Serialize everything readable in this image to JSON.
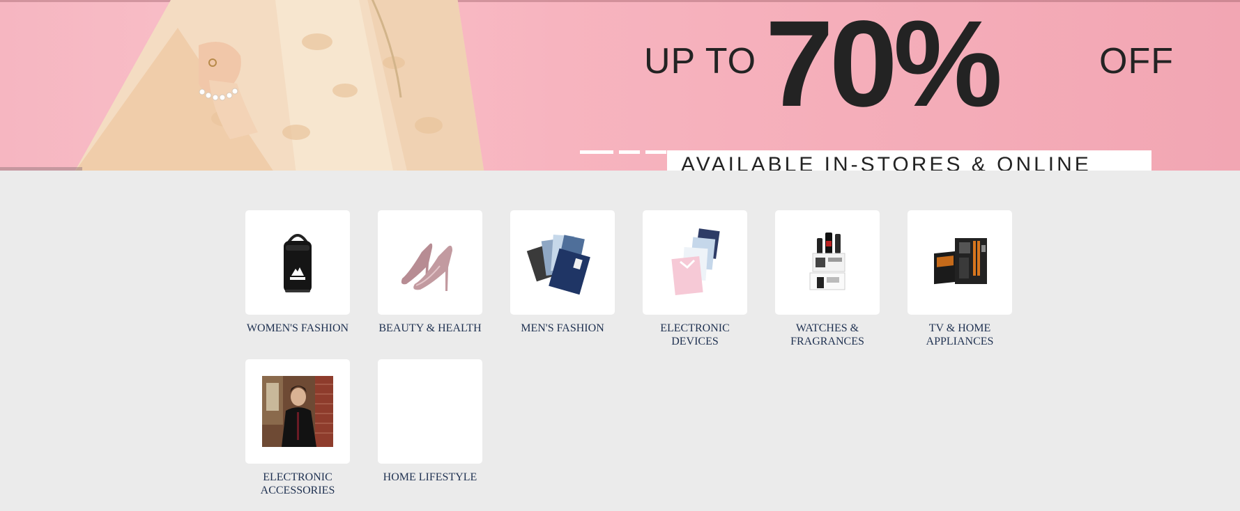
{
  "hero": {
    "prefix": "UP TO",
    "discount": "70%",
    "suffix": "OFF",
    "strip": "AVAILABLE IN-STORES & ONLINE"
  },
  "categories": [
    {
      "label": "WOMEN'S FASHION",
      "icon": "backpack-icon"
    },
    {
      "label": "BEAUTY & HEALTH",
      "icon": "high-heels-icon"
    },
    {
      "label": "MEN'S FASHION",
      "icon": "folded-shirts-icon"
    },
    {
      "label": "ELECTRONIC DEVICES",
      "icon": "shirt-stack-icon"
    },
    {
      "label": "WATCHES & FRAGRANCES",
      "icon": "fragrance-giftset-icon"
    },
    {
      "label": "TV & HOME APPLIANCES",
      "icon": "motherboard-icon"
    },
    {
      "label": "ELECTRONIC ACCESSORIES",
      "icon": "model-photo-icon"
    },
    {
      "label": "HOME LIFESTYLE",
      "icon": ""
    }
  ]
}
